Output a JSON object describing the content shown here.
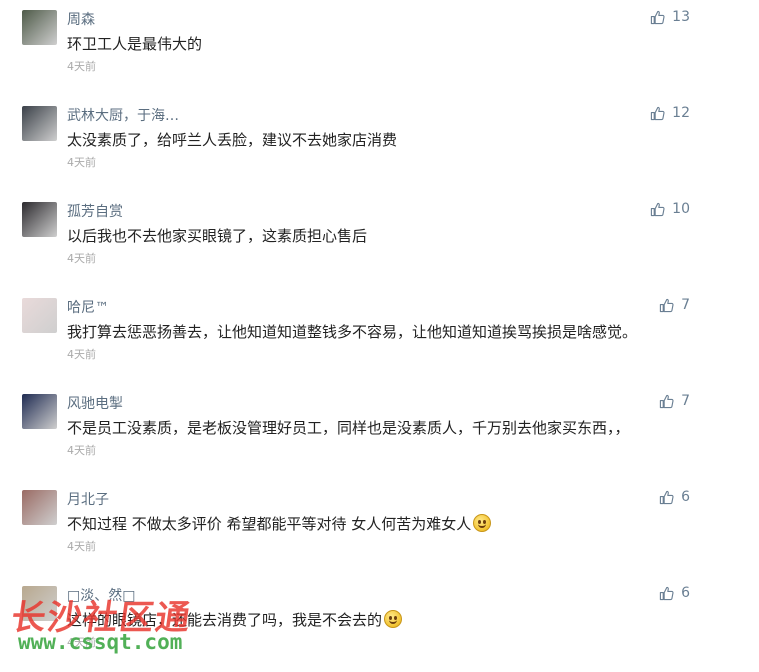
{
  "comments": [
    {
      "username": "周森",
      "text": "环卫工人是最伟大的",
      "time": "4天前",
      "likes": "13",
      "avatar_color": "#4e5a48"
    },
    {
      "username": "武林大厨，于海…",
      "text": "太没素质了，给呼兰人丢脸，建议不去她家店消费",
      "time": "4天前",
      "likes": "12",
      "avatar_color": "#3a4048"
    },
    {
      "username": "孤芳自赏",
      "text": "以后我也不去他家买眼镜了，这素质担心售后",
      "time": "4天前",
      "likes": "10",
      "avatar_color": "#2c2a2e"
    },
    {
      "username": "哈尼™",
      "text": "我打算去惩恶扬善去，让他知道知道整钱多不容易，让他知道知道挨骂挨损是啥感觉。",
      "time": "4天前",
      "likes": "7",
      "avatar_color": "#e9dada"
    },
    {
      "username": "风驰电掣",
      "text": "不是员工没素质，是老板没管理好员工，同样也是没素质人，千万别去他家买东西，，",
      "time": "4天前",
      "likes": "7",
      "avatar_color": "#1f2b52"
    },
    {
      "username": "月北子",
      "text": "不知过程 不做太多评价  希望都能平等对待 女人何苦为难女人",
      "time": "4天前",
      "likes": "6",
      "avatar_color": "#9a6b64"
    },
    {
      "username": "□淡、然□",
      "text": "这样的眼镜店，还能去消费了吗，我是不会去的",
      "time": "4天前",
      "likes": "6",
      "avatar_color": "#b8a88e"
    }
  ],
  "watermark": {
    "text": "长沙社区通",
    "url": "www.cssqt.com"
  },
  "icons": {
    "like": "thumbs-up-icon",
    "emoji": "smiley-emoji-icon"
  }
}
